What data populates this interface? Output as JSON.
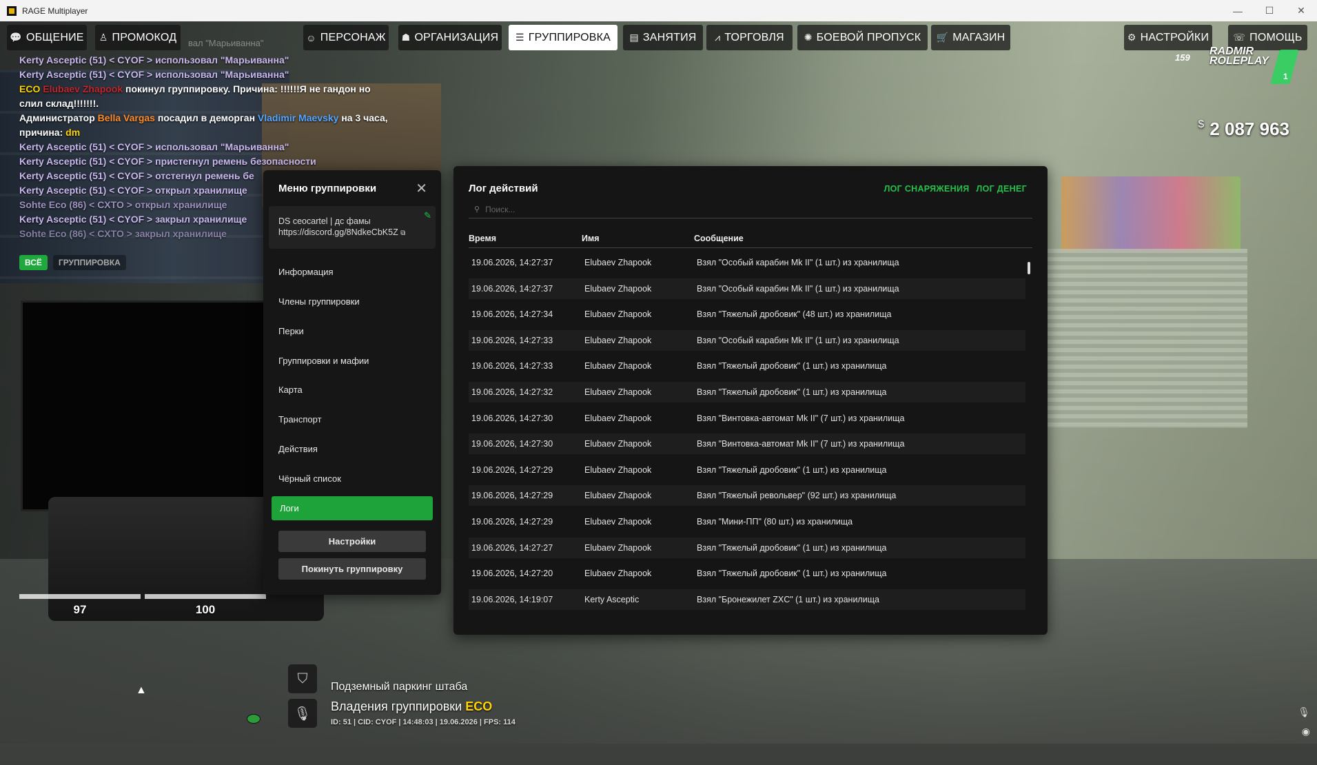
{
  "window": {
    "title": "RAGE Multiplayer",
    "minimize": "—",
    "maximize": "☐",
    "close": "✕"
  },
  "nav": {
    "tabs": [
      {
        "label": "ОБЩЕНИЕ",
        "icon": "💬"
      },
      {
        "label": "ПРОМОКОД",
        "icon": "♙"
      },
      {
        "label": "ПЕРСОНАЖ",
        "icon": "☺"
      },
      {
        "label": "ОРГАНИЗАЦИЯ",
        "icon": "☗"
      },
      {
        "label": "ГРУППИРОВКА",
        "icon": "☰"
      },
      {
        "label": "ЗАНЯТИЯ",
        "icon": "▤"
      },
      {
        "label": "ТОРГОВЛЯ",
        "icon": "⩘"
      },
      {
        "label": "БОЕВОЙ ПРОПУСК",
        "icon": "✺"
      },
      {
        "label": "МАГАЗИН",
        "icon": "🛒"
      },
      {
        "label": "НАСТРОЙКИ",
        "icon": "⚙"
      },
      {
        "label": "ПОМОЩЬ",
        "icon": "☏"
      }
    ],
    "ghost_text": "вал \"Марьиванна\""
  },
  "chat": {
    "l1": "Kerty Asceptic (51) < CYOF > использовал \"Марьиванна\"",
    "l2": "Kerty Asceptic (51) < CYOF > использовал \"Марьиванна\"",
    "l3": {
      "tag": "ECO",
      "name": "Elubaev Zhapook",
      "rest": " покинул группировку. Причина: !!!!!!Я не гандон но",
      "rest2": "слил склад!!!!!!!."
    },
    "l4": {
      "prefix": "Администратор ",
      "admin": "Bella Vargas",
      "mid": " посадил в деморган ",
      "target": "Vladimir Maevsky",
      "rest": " на 3 часа,",
      "reason_label": "причина: ",
      "reason": "dm"
    },
    "l5": "Kerty Asceptic (51) < CYOF > использовал \"Марьиванна\"",
    "l6": "Kerty Asceptic (51) < CYOF > пристегнул ремень безопасности",
    "l7": "Kerty Asceptic (51) < CYOF > отстегнул ремень бе",
    "l8": "Kerty Asceptic (51) < CYOF > открыл хранилище",
    "l9": "Sohte Eco (86) < CXTO > открыл хранилище",
    "l10": "Kerty Asceptic (51) < CYOF > закрыл хранилище",
    "l11": "Sohte Eco (86) < CXTO > закрыл хранилище",
    "tab_all": "ВСЁ",
    "tab_group": "ГРУППИРОВКА"
  },
  "hud": {
    "health": "97",
    "armor": "100",
    "health_frac": 1.0,
    "armor_frac": 1.0
  },
  "menu": {
    "title": "Меню группировки",
    "close": "✕",
    "note_line1": "DS ceocartel | дс фамы",
    "note_line2": "https://discord.gg/8NdkeCbK5Z",
    "items": [
      "Информация",
      "Члены группировки",
      "Перки",
      "Группировки и мафии",
      "Карта",
      "Транспорт",
      "Действия",
      "Чёрный список",
      "Логи"
    ],
    "settings_btn": "Настройки",
    "leave_btn": "Покинуть группировку"
  },
  "log": {
    "title": "Лог действий",
    "link_equipment": "ЛОГ СНАРЯЖЕНИЯ",
    "link_money": "ЛОГ ДЕНЕГ",
    "search_placeholder": "Поиск...",
    "col_time": "Время",
    "col_name": "Имя",
    "col_message": "Сообщение",
    "rows": [
      {
        "time": "19.06.2026, 14:27:37",
        "name": "Elubaev Zhapook",
        "msg": "Взял \"Особый карабин Mk II\" (1 шт.) из хранилища"
      },
      {
        "time": "19.06.2026, 14:27:37",
        "name": "Elubaev Zhapook",
        "msg": "Взял \"Особый карабин Mk II\" (1 шт.) из хранилища"
      },
      {
        "time": "19.06.2026, 14:27:34",
        "name": "Elubaev Zhapook",
        "msg": "Взял \"Тяжелый дробовик\" (48 шт.) из хранилища"
      },
      {
        "time": "19.06.2026, 14:27:33",
        "name": "Elubaev Zhapook",
        "msg": "Взял \"Особый карабин Mk II\" (1 шт.) из хранилища"
      },
      {
        "time": "19.06.2026, 14:27:33",
        "name": "Elubaev Zhapook",
        "msg": "Взял \"Тяжелый дробовик\" (1 шт.) из хранилища"
      },
      {
        "time": "19.06.2026, 14:27:32",
        "name": "Elubaev Zhapook",
        "msg": "Взял \"Тяжелый дробовик\" (1 шт.) из хранилища"
      },
      {
        "time": "19.06.2026, 14:27:30",
        "name": "Elubaev Zhapook",
        "msg": "Взял \"Винтовка-автомат Mk II\" (7 шт.) из хранилища"
      },
      {
        "time": "19.06.2026, 14:27:30",
        "name": "Elubaev Zhapook",
        "msg": "Взял \"Винтовка-автомат Mk II\" (7 шт.) из хранилища"
      },
      {
        "time": "19.06.2026, 14:27:29",
        "name": "Elubaev Zhapook",
        "msg": "Взял \"Тяжелый дробовик\" (1 шт.) из хранилища"
      },
      {
        "time": "19.06.2026, 14:27:29",
        "name": "Elubaev Zhapook",
        "msg": "Взял \"Тяжелый револьвер\" (92 шт.) из хранилища"
      },
      {
        "time": "19.06.2026, 14:27:29",
        "name": "Elubaev Zhapook",
        "msg": "Взял \"Мини-ПП\" (80 шт.) из хранилища"
      },
      {
        "time": "19.06.2026, 14:27:27",
        "name": "Elubaev Zhapook",
        "msg": "Взял \"Тяжелый дробовик\" (1 шт.) из хранилища"
      },
      {
        "time": "19.06.2026, 14:27:20",
        "name": "Elubaev Zhapook",
        "msg": "Взял \"Тяжелый дробовик\" (1 шт.) из хранилища"
      },
      {
        "time": "19.06.2026, 14:19:07",
        "name": "Kerty Asceptic",
        "msg": "Взял \"Бронежилет ZXC\" (1 шт.) из хранилища"
      }
    ]
  },
  "location": {
    "place": "Подземный паркинг штаба",
    "owner_prefix": "Владения группировки ",
    "owner": "ECO",
    "info": "ID: 51 | CID: CYOF | 14:48:03  | 19.06.2026 | FPS: 114"
  },
  "status": {
    "money_symbol": "$",
    "money": "2 087 963",
    "online": "159",
    "logo_line1": "RADMIR",
    "logo_line2": "ROLEPLAY",
    "server_num": "1"
  },
  "colors": {
    "accent": "#1ea33b",
    "link": "#25c14b",
    "panel": "#151515"
  }
}
